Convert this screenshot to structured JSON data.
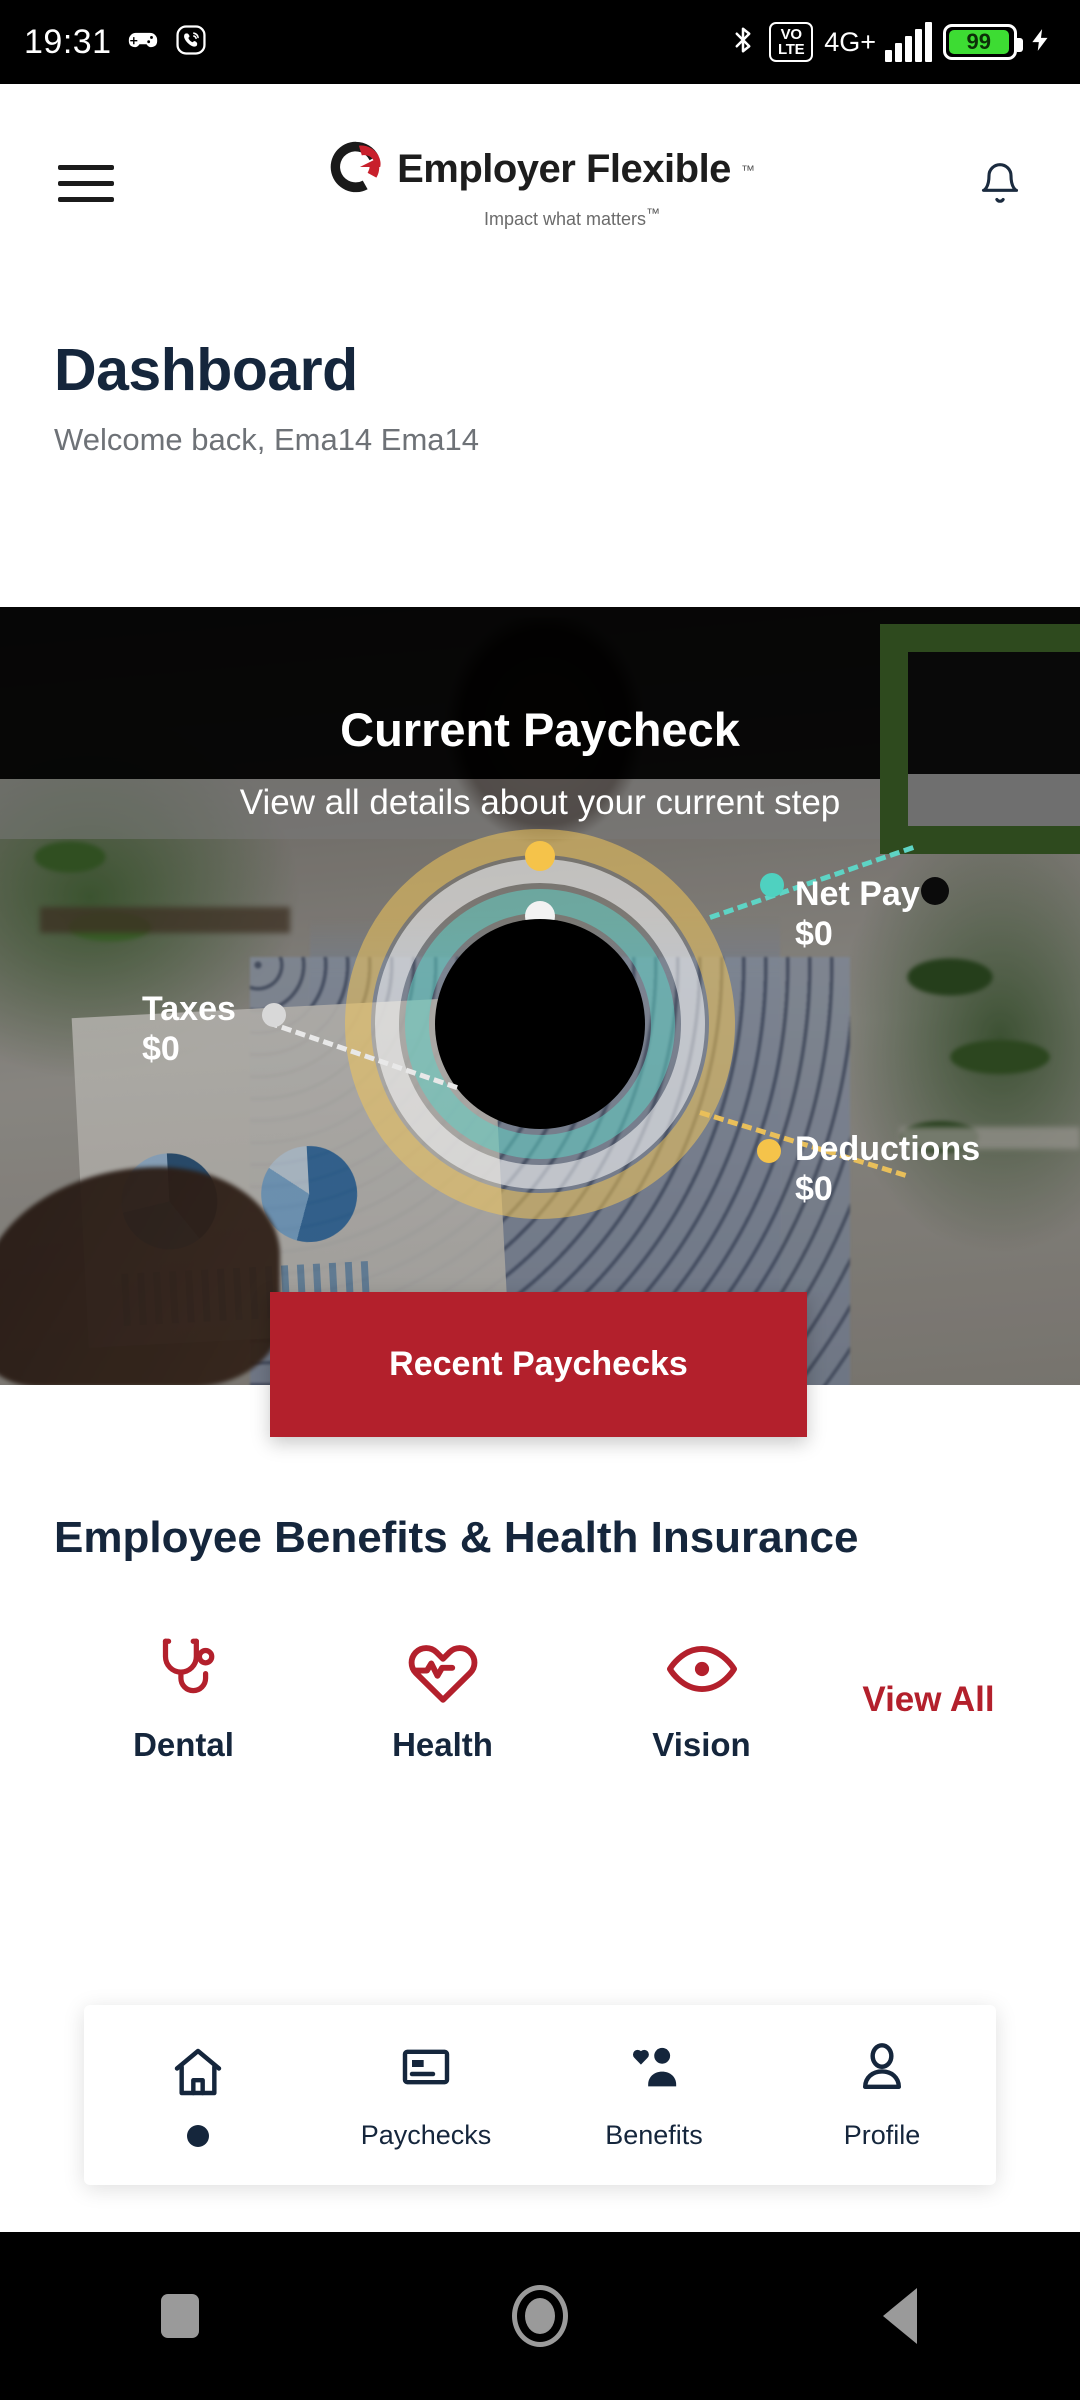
{
  "status_bar": {
    "time": "19:31",
    "icons_left": [
      "game-controller-icon",
      "viber-icon"
    ],
    "bluetooth": "bluetooth-icon",
    "volte_top": "VO",
    "volte_bottom": "LTE",
    "network": "4G+",
    "signal_bars": 5,
    "battery_percent": "99",
    "battery_color": "#3ddc33",
    "charging": true
  },
  "header": {
    "menu_icon": "hamburger-menu-icon",
    "logo_mark": "employer-flexible-e-icon",
    "logo_name": "Employer Flexible",
    "logo_tm": "™",
    "logo_tagline": "Impact what matters",
    "tagline_tm": "™",
    "notification_icon": "bell-icon"
  },
  "page": {
    "title": "Dashboard",
    "subtitle": "Welcome back, Ema14 Ema14"
  },
  "hero": {
    "title": "Current Paycheck",
    "subtitle": "View all details about your current step",
    "stats": [
      {
        "label": "Taxes",
        "value": "$0",
        "dot_color": "#d8d8d8"
      },
      {
        "label": "Net Pay",
        "value": "$0",
        "dot_color": "#4fd1c0"
      },
      {
        "label": "Deductions",
        "value": "$0",
        "dot_color": "#f5c34a"
      }
    ],
    "ring_colors": [
      "#f0c45a",
      "#ffffff",
      "#63cfc4"
    ],
    "cta_label": "Recent Paychecks",
    "cta_color": "#b3202c"
  },
  "benefits": {
    "section_title": "Employee Benefits & Health Insurance",
    "items": [
      {
        "label": "Dental",
        "icon": "stethoscope-icon"
      },
      {
        "label": "Health",
        "icon": "heart-pulse-icon"
      },
      {
        "label": "Vision",
        "icon": "eye-icon"
      }
    ],
    "view_all_label": "View All",
    "accent_color": "#b3202c"
  },
  "bottom_nav": {
    "items": [
      {
        "label": "",
        "icon": "home-icon",
        "active": true
      },
      {
        "label": "Paychecks",
        "icon": "paycheck-card-icon",
        "active": false
      },
      {
        "label": "Benefits",
        "icon": "benefits-people-icon",
        "active": false
      },
      {
        "label": "Profile",
        "icon": "person-icon",
        "active": false
      }
    ]
  },
  "android_nav": {
    "recents": "square-recents-icon",
    "home": "circle-home-icon",
    "back": "triangle-back-icon"
  },
  "colors": {
    "brand_red": "#b3202c",
    "navy": "#15263c",
    "gray_text": "#6e7277"
  }
}
